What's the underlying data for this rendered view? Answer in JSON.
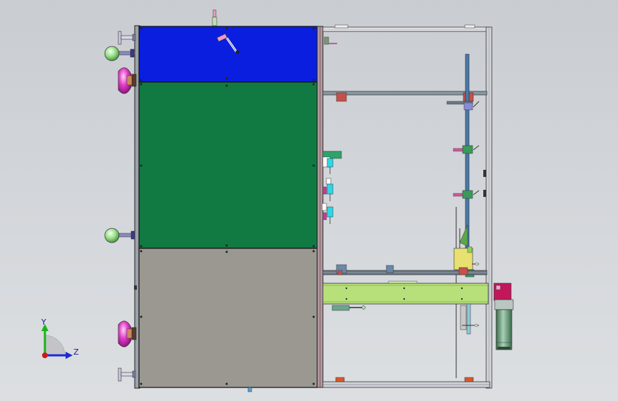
{
  "viewport": {
    "background": "#d3d6da",
    "view_mode": "shaded-with-edges",
    "orientation": "side"
  },
  "model": {
    "panels": [
      {
        "name": "top-panel",
        "color": "#0a1ee0"
      },
      {
        "name": "middle-panel",
        "color": "#117a42"
      },
      {
        "name": "bottom-panel",
        "color": "#9a9890"
      }
    ],
    "frame_color": "#5a6470",
    "conveyor_color": "#b8e07a",
    "motor_color": "#5a8a6a",
    "motor_cap_color": "#c2185b",
    "handle_color": "#e23cc8"
  },
  "triad": {
    "y_label": "Y",
    "z_label": "Z",
    "y_color": "#18b418",
    "z_color": "#1a2ad8",
    "x_color": "#d01818"
  }
}
